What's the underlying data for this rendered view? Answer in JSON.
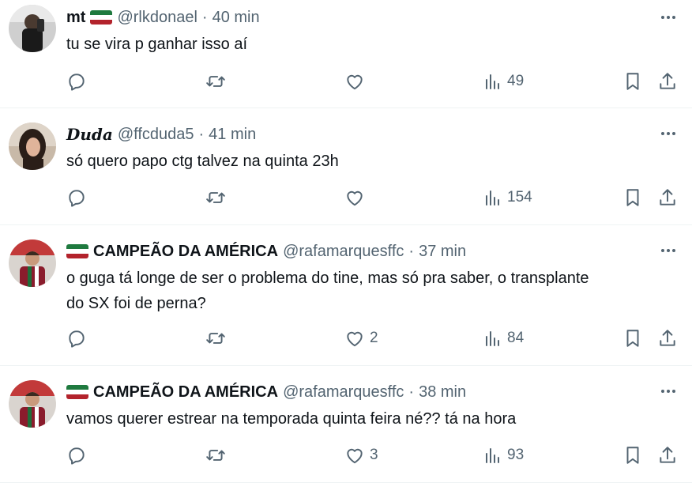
{
  "tweets": [
    {
      "name": "mt",
      "handle": "@rlkdonael",
      "dot": "·",
      "time": "40 min",
      "text": [
        "tu se vira p ganhar isso aí"
      ],
      "likes": "",
      "views": "49",
      "avatar": "profile-photo-dark"
    },
    {
      "name": "Duda",
      "handle": "@ffcduda5",
      "dot": "·",
      "time": "41 min",
      "text": [
        "só quero papo ctg talvez na quinta 23h"
      ],
      "likes": "",
      "views": "154",
      "avatar": "profile-photo-woman"
    },
    {
      "name": "CAMPEÃO DA AMÉRICA",
      "handle": "@rafamarquesffc",
      "dot": "·",
      "time": "37 min",
      "text": [
        "o guga tá longe de ser o problema do tine, mas só pra saber, o transplante",
        "do SX foi de perna?"
      ],
      "likes": "2",
      "views": "84",
      "avatar": "profile-photo-player"
    },
    {
      "name": "CAMPEÃO DA AMÉRICA",
      "handle": "@rafamarquesffc",
      "dot": "·",
      "time": "38 min",
      "text": [
        "vamos querer estrear na temporada quinta feira né?? tá na hora"
      ],
      "likes": "3",
      "views": "93",
      "avatar": "profile-photo-player"
    }
  ],
  "icons": {
    "reply": "reply-icon",
    "retweet": "retweet-icon",
    "like": "heart-icon",
    "views": "views-icon",
    "bookmark": "bookmark-icon",
    "share": "share-icon",
    "more": "more-icon"
  },
  "colors": {
    "text": "#0f1419",
    "secondary": "#536471",
    "divider": "#eff3f4",
    "flag_green": "#1f7a3f",
    "flag_red": "#b3232c"
  }
}
